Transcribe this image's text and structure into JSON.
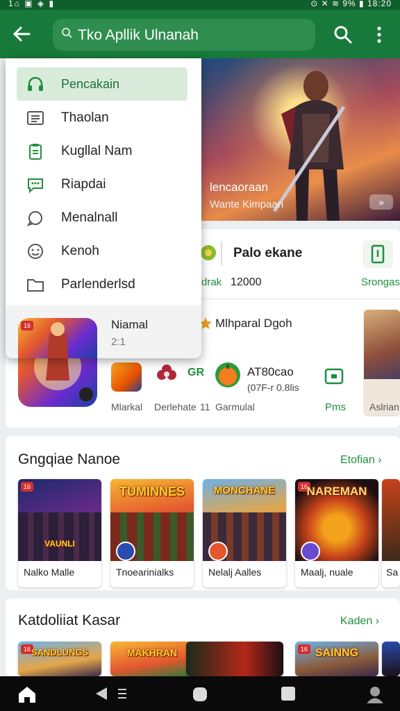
{
  "status_bar": {
    "left_icons": "1⌂ ▣ ◈ ▮",
    "right_text": "⊙ ✕ ≋ 9% ▮ 18:20"
  },
  "app_bar": {
    "search_text": "Tko Apllik Ulnanah"
  },
  "drawer": {
    "items": [
      {
        "label": "Pencakain",
        "icon": "headset-icon",
        "selected": true
      },
      {
        "label": "Thaolan",
        "icon": "list-icon"
      },
      {
        "label": "Kugllal Nam",
        "icon": "clipboard-icon"
      },
      {
        "label": "Riapdai",
        "icon": "chat-icon"
      },
      {
        "label": "Menalnall",
        "icon": "support-icon"
      },
      {
        "label": "Kenoh",
        "icon": "smiley-icon"
      },
      {
        "label": "Parlenderlsd",
        "icon": "folder-icon"
      }
    ],
    "footer": {
      "title": "Niamal",
      "subtitle": "2:1"
    }
  },
  "hero": {
    "title": "lencaoraan",
    "subtitle": "Wante Kimpaan",
    "more": "»"
  },
  "promo": {
    "header_title": "Palo ekane",
    "header_left_label": "drak",
    "header_number": "12000",
    "header_right_label": "Srongas",
    "featured_title": "Mlhparal Dgoh",
    "price_title": "AT80cao",
    "price_sub": "(07F-r 0.8lis",
    "app_labels": [
      "Mlarkal",
      "Derlehate",
      "11",
      "Garmulal",
      "Pms",
      "Aslrian"
    ],
    "gr_text": "GR"
  },
  "section_one": {
    "title": "Gngqiae Nanoe",
    "link": "Etofian ›",
    "cards": [
      {
        "name": "Nalko Malle",
        "art_text": "VAUNLI"
      },
      {
        "name": "Tnoearinialks",
        "art_text": "TUMINNES"
      },
      {
        "name": "Nelalj Aalles",
        "art_text": "MONCHANE"
      },
      {
        "name": "Maalj, nuale",
        "art_text": "NAREMAN"
      },
      {
        "name": "Sa",
        "art_text": ""
      }
    ]
  },
  "section_two": {
    "title": "Katdoliiat Kasar",
    "link": "Kaden ›",
    "cards": [
      {
        "art_text": "SANDLUNGS"
      },
      {
        "art_text": "MAKHRAN"
      },
      {
        "art_text": ""
      },
      {
        "art_text": "SAINNG"
      },
      {
        "art_text": ""
      }
    ]
  },
  "colors": {
    "primary": "#187a3a",
    "status": "#0f5f2c",
    "accent": "#1e8e3e"
  }
}
